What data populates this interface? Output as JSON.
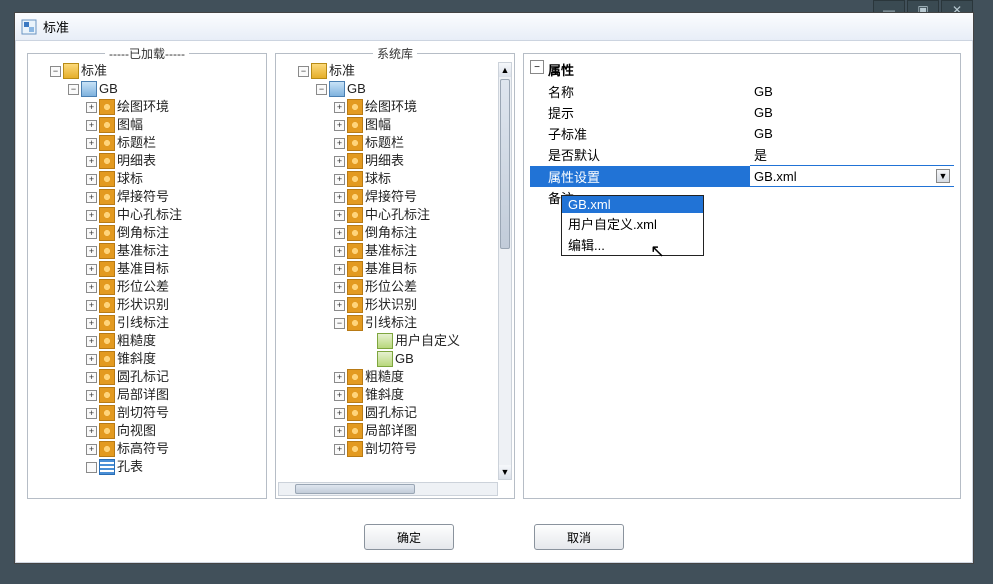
{
  "window": {
    "title": "标准"
  },
  "panels": {
    "loaded_label": "-----已加载-----",
    "library_label": "系统库"
  },
  "tree_loaded": {
    "root": "标准",
    "gb": "GB",
    "items": [
      "绘图环境",
      "图幅",
      "标题栏",
      "明细表",
      "球标",
      "焊接符号",
      "中心孔标注",
      "倒角标注",
      "基准标注",
      "基准目标",
      "形位公差",
      "形状识别",
      "引线标注",
      "粗糙度",
      "锥斜度",
      "圆孔标记",
      "局部详图",
      "剖切符号",
      "向视图",
      "标高符号",
      "孔表"
    ]
  },
  "tree_library": {
    "root": "标准",
    "gb": "GB",
    "items_top": [
      "绘图环境",
      "图幅",
      "标题栏",
      "明细表",
      "球标",
      "焊接符号",
      "中心孔标注",
      "倒角标注",
      "基准标注",
      "基准目标",
      "形位公差",
      "形状识别"
    ],
    "leader": {
      "label": "引线标注",
      "children": [
        "用户自定义",
        "GB"
      ]
    },
    "items_bottom": [
      "粗糙度",
      "锥斜度",
      "圆孔标记",
      "局部详图",
      "剖切符号"
    ]
  },
  "properties": {
    "header": "属性",
    "rows": [
      {
        "name": "名称",
        "value": "GB"
      },
      {
        "name": "提示",
        "value": "GB"
      },
      {
        "name": "子标准",
        "value": "GB"
      },
      {
        "name": "是否默认",
        "value": "是"
      },
      {
        "name": "属性设置",
        "value": "GB.xml",
        "selected": true
      },
      {
        "name": "备注",
        "value": ""
      }
    ]
  },
  "dropdown": {
    "options": [
      "GB.xml",
      "用户自定义.xml",
      "编辑..."
    ],
    "selected": "GB.xml"
  },
  "buttons": {
    "ok": "确定",
    "cancel": "取消"
  }
}
